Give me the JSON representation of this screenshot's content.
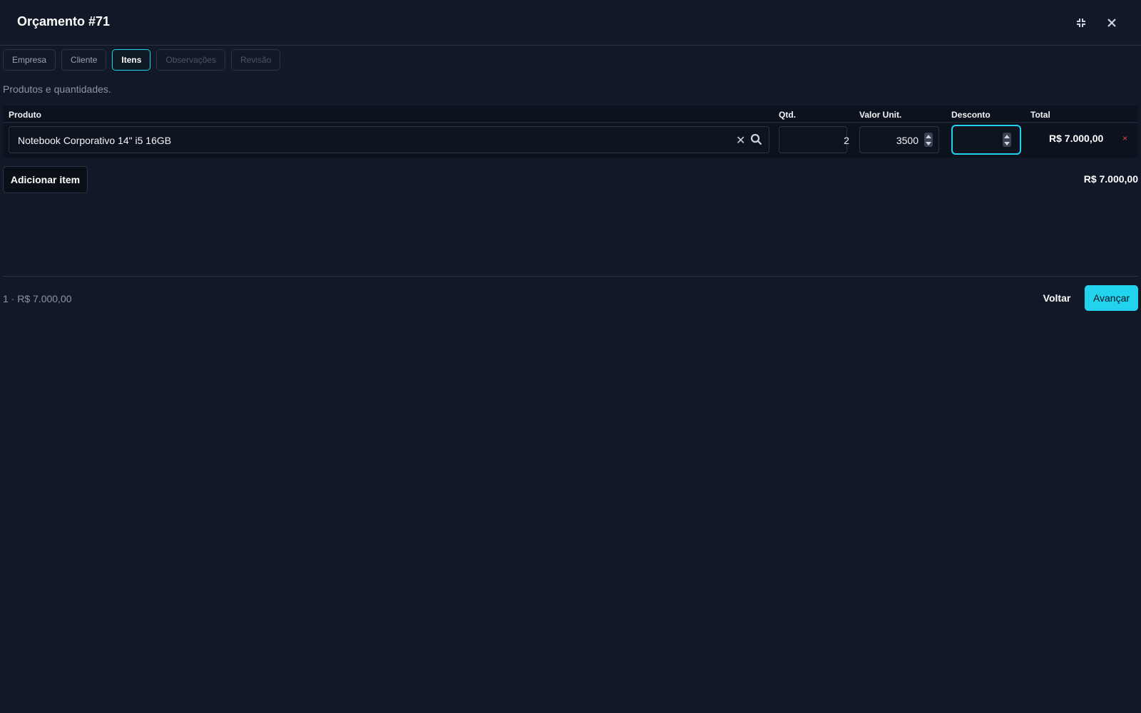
{
  "header": {
    "title": "Orçamento #71",
    "collapse_icon": "collapse-icon",
    "close_icon": "close-icon"
  },
  "tabs": [
    {
      "label": "Empresa",
      "state": "normal"
    },
    {
      "label": "Cliente",
      "state": "normal"
    },
    {
      "label": "Itens",
      "state": "active"
    },
    {
      "label": "Observações",
      "state": "disabled"
    },
    {
      "label": "Revisão",
      "state": "disabled"
    }
  ],
  "subtitle": "Produtos e quantidades.",
  "table": {
    "headers": {
      "product": "Produto",
      "qty": "Qtd.",
      "unit": "Valor Unit.",
      "discount": "Desconto",
      "total": "Total"
    },
    "rows": [
      {
        "product": "Notebook Corporativo 14\" i5 16GB",
        "qty": "2",
        "unit_value": "3500",
        "discount": "",
        "total": "R$ 7.000,00",
        "remove": "×"
      }
    ]
  },
  "actions": {
    "add_item": "Adicionar item",
    "grand_total": "R$ 7.000,00"
  },
  "footer": {
    "summary": "1 · R$ 7.000,00",
    "back": "Voltar",
    "next": "Avançar"
  },
  "colors": {
    "accent": "#22d3ee",
    "background": "#111827",
    "danger": "#ef4444"
  }
}
